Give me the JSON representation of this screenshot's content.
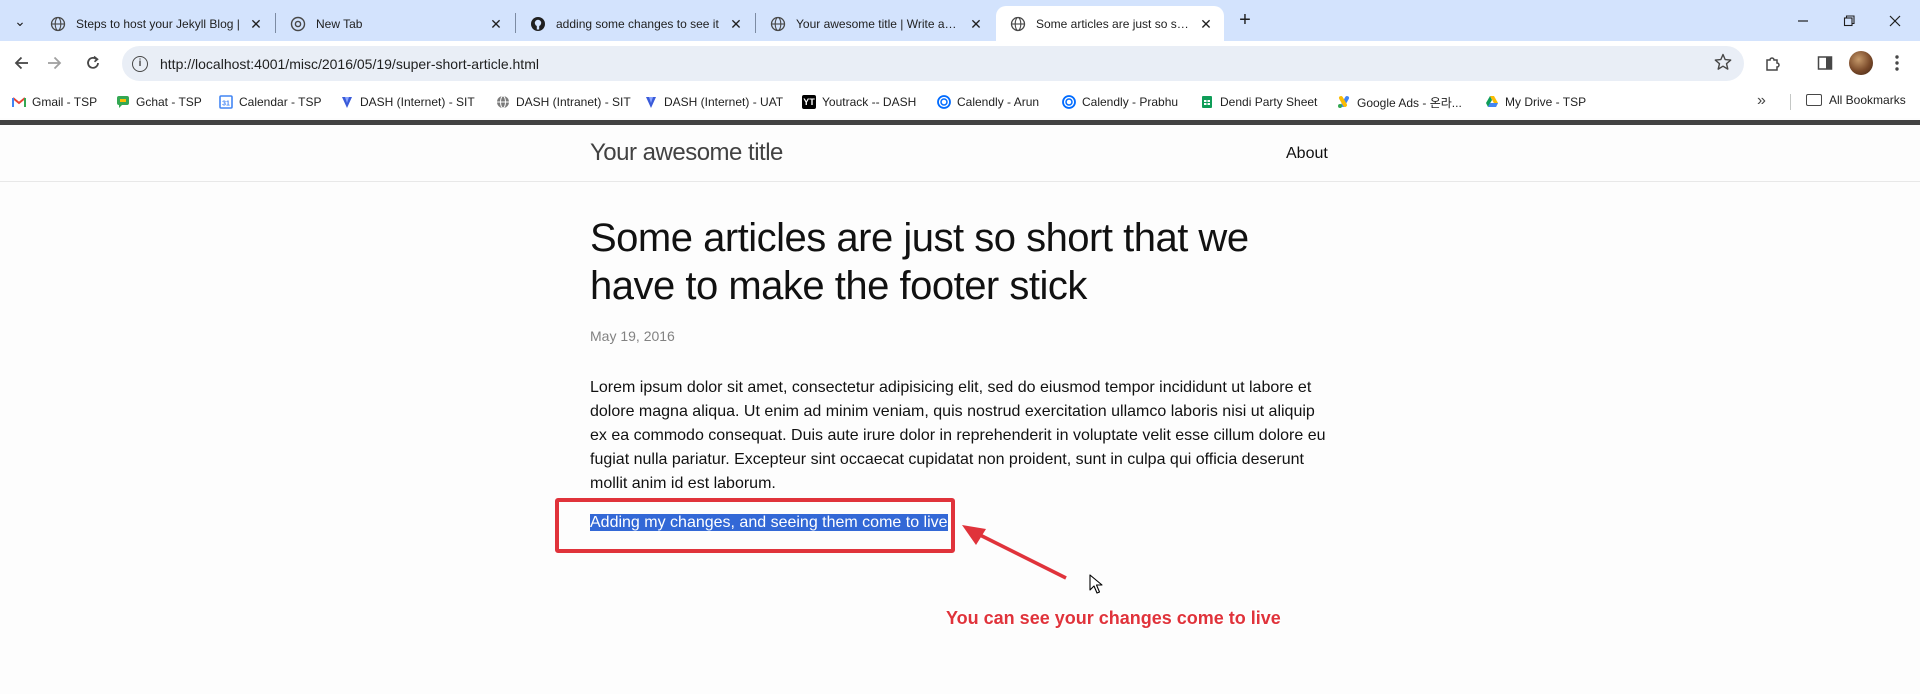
{
  "browser": {
    "tabs": [
      {
        "title": "Steps to host your Jekyll Blog |"
      },
      {
        "title": "New Tab"
      },
      {
        "title": "adding some changes to see it"
      },
      {
        "title": "Your awesome title | Write an a"
      },
      {
        "title": "Some articles are just so short t",
        "active": true
      }
    ],
    "url": "http://localhost:4001/misc/2016/05/19/super-short-article.html",
    "bookmarks": [
      {
        "label": "Gmail - TSP",
        "icon": "gmail-icon"
      },
      {
        "label": "Gchat - TSP",
        "icon": "gchat-icon"
      },
      {
        "label": "Calendar - TSP",
        "icon": "calendar-icon"
      },
      {
        "label": "DASH (Internet) - SIT",
        "icon": "dash-icon"
      },
      {
        "label": "DASH (Intranet) - SIT",
        "icon": "globe-icon"
      },
      {
        "label": "DASH (Internet) - UAT",
        "icon": "dash-icon"
      },
      {
        "label": "Youtrack -- DASH",
        "icon": "youtrack-icon"
      },
      {
        "label": "Calendly - Arun",
        "icon": "calendly-icon"
      },
      {
        "label": "Calendly - Prabhu",
        "icon": "calendly-icon"
      },
      {
        "label": "Dendi Party Sheet",
        "icon": "sheets-icon"
      },
      {
        "label": "Google Ads - 온라...",
        "icon": "google-ads-icon"
      },
      {
        "label": "My Drive - TSP",
        "icon": "drive-icon"
      }
    ],
    "all_bookmarks_label": "All Bookmarks"
  },
  "site": {
    "title": "Your awesome title",
    "nav_about": "About"
  },
  "post": {
    "title": "Some articles are just so short that we have to make the footer stick",
    "date": "May 19, 2016",
    "body": "Lorem ipsum dolor sit amet, consectetur adipisicing elit, sed do eiusmod tempor incididunt ut labore et dolore magna aliqua. Ut enim ad minim veniam, quis nostrud exercitation ullamco laboris nisi ut aliquip ex ea commodo consequat. Duis aute irure dolor in reprehenderit in voluptate velit esse cillum dolore eu fugiat nulla pariatur. Excepteur sint occaecat cupidatat non proident, sunt in culpa qui officia deserunt mollit anim id est laborum.",
    "highlighted_line": "Adding my changes, and seeing them come to live"
  },
  "annotation": {
    "text": "You can see your changes come to live",
    "color": "#e0333b"
  },
  "colors": {
    "tabstrip": "#d3e3fd",
    "selection": "#3368d6"
  }
}
